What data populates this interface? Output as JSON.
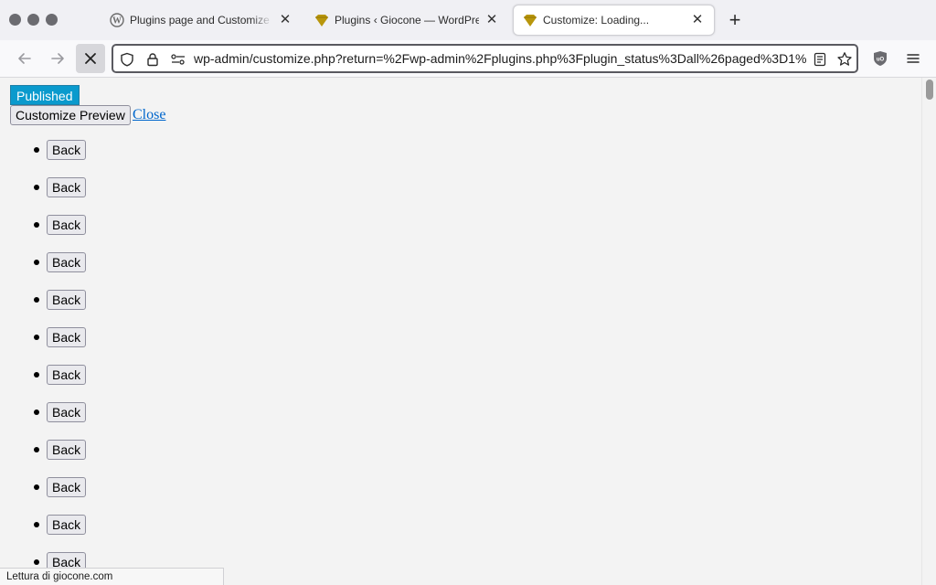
{
  "browser": {
    "tabs": [
      {
        "title": "Plugins page and Customize do",
        "icon": "wordpress-icon",
        "active": false
      },
      {
        "title": "Plugins ‹ Giocone — WordPress",
        "icon": "gold-diamond-icon",
        "active": false
      },
      {
        "title": "Customize: Loading...",
        "icon": "gold-diamond-icon",
        "active": true
      }
    ],
    "url": "wp-admin/customize.php?return=%2Fwp-admin%2Fplugins.php%3Fplugin_status%3Dall%26paged%3D1%",
    "status_text": "Lettura di giocone.com"
  },
  "page": {
    "status_badge": "Published",
    "customize_button": "Customize Preview",
    "close_link": "Close",
    "back_items": [
      "Back",
      "Back",
      "Back",
      "Back",
      "Back",
      "Back",
      "Back",
      "Back",
      "Back",
      "Back",
      "Back",
      "Back"
    ]
  },
  "colors": {
    "badge_bg": "#0a9acd",
    "link": "#0066cc",
    "favicon_gold": "#b8960c"
  }
}
